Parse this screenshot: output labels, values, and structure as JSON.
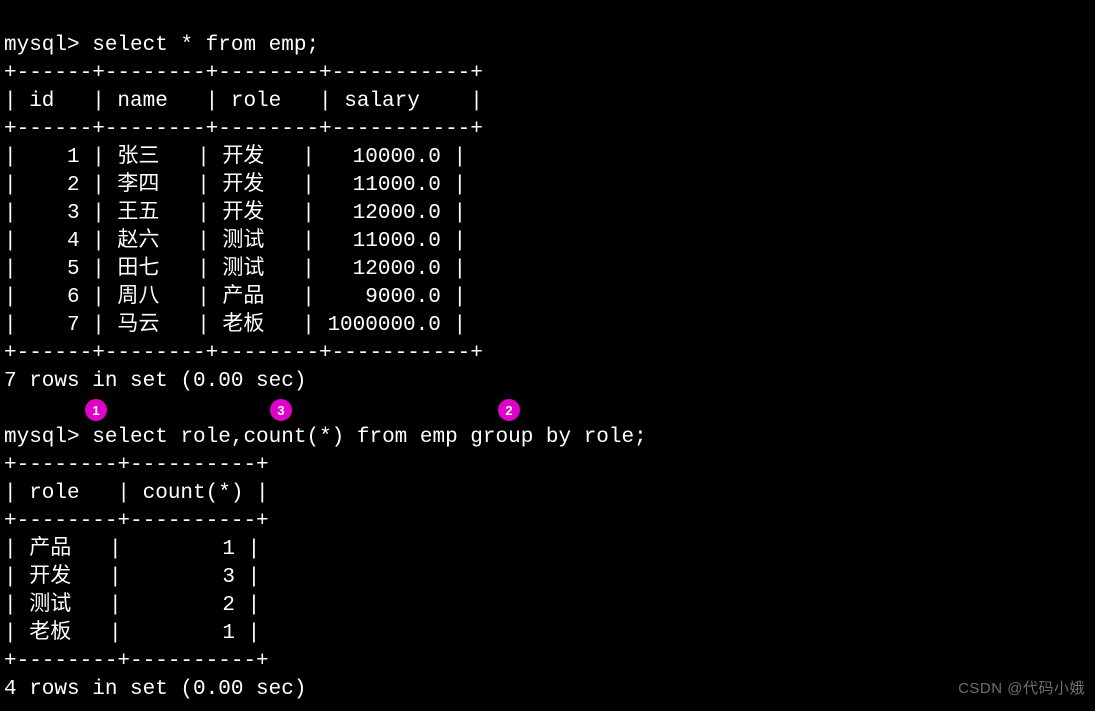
{
  "query1": {
    "prompt": "mysql>",
    "sql": " select * from emp;",
    "border_top": "+------+--------+--------+-----------+",
    "header": "| id   | name   | role   | salary    |",
    "border_mid": "+------+--------+--------+-----------+",
    "rows": [
      "|    1 | 张三   | 开发   |   10000.0 |",
      "|    2 | 李四   | 开发   |   11000.0 |",
      "|    3 | 王五   | 开发   |   12000.0 |",
      "|    4 | 赵六   | 测试   |   11000.0 |",
      "|    5 | 田七   | 测试   |   12000.0 |",
      "|    6 | 周八   | 产品   |    9000.0 |",
      "|    7 | 马云   | 老板   | 1000000.0 |"
    ],
    "border_bot": "+------+--------+--------+-----------+",
    "status": "7 rows in set (0.00 sec)"
  },
  "query2": {
    "prompt": "mysql>",
    "sql": " select role,count(*) from emp group by role;",
    "border_top": "+--------+----------+",
    "header": "| role   | count(*) |",
    "border_mid": "+--------+----------+",
    "rows": [
      "| 产品   |        1 |",
      "| 开发   |        3 |",
      "| 测试   |        2 |",
      "| 老板   |        1 |"
    ],
    "border_bot": "+--------+----------+",
    "status": "4 rows in set (0.00 sec)"
  },
  "badges": {
    "b1": "1",
    "b2": "2",
    "b3": "3"
  },
  "watermark": "CSDN @代码小娥"
}
